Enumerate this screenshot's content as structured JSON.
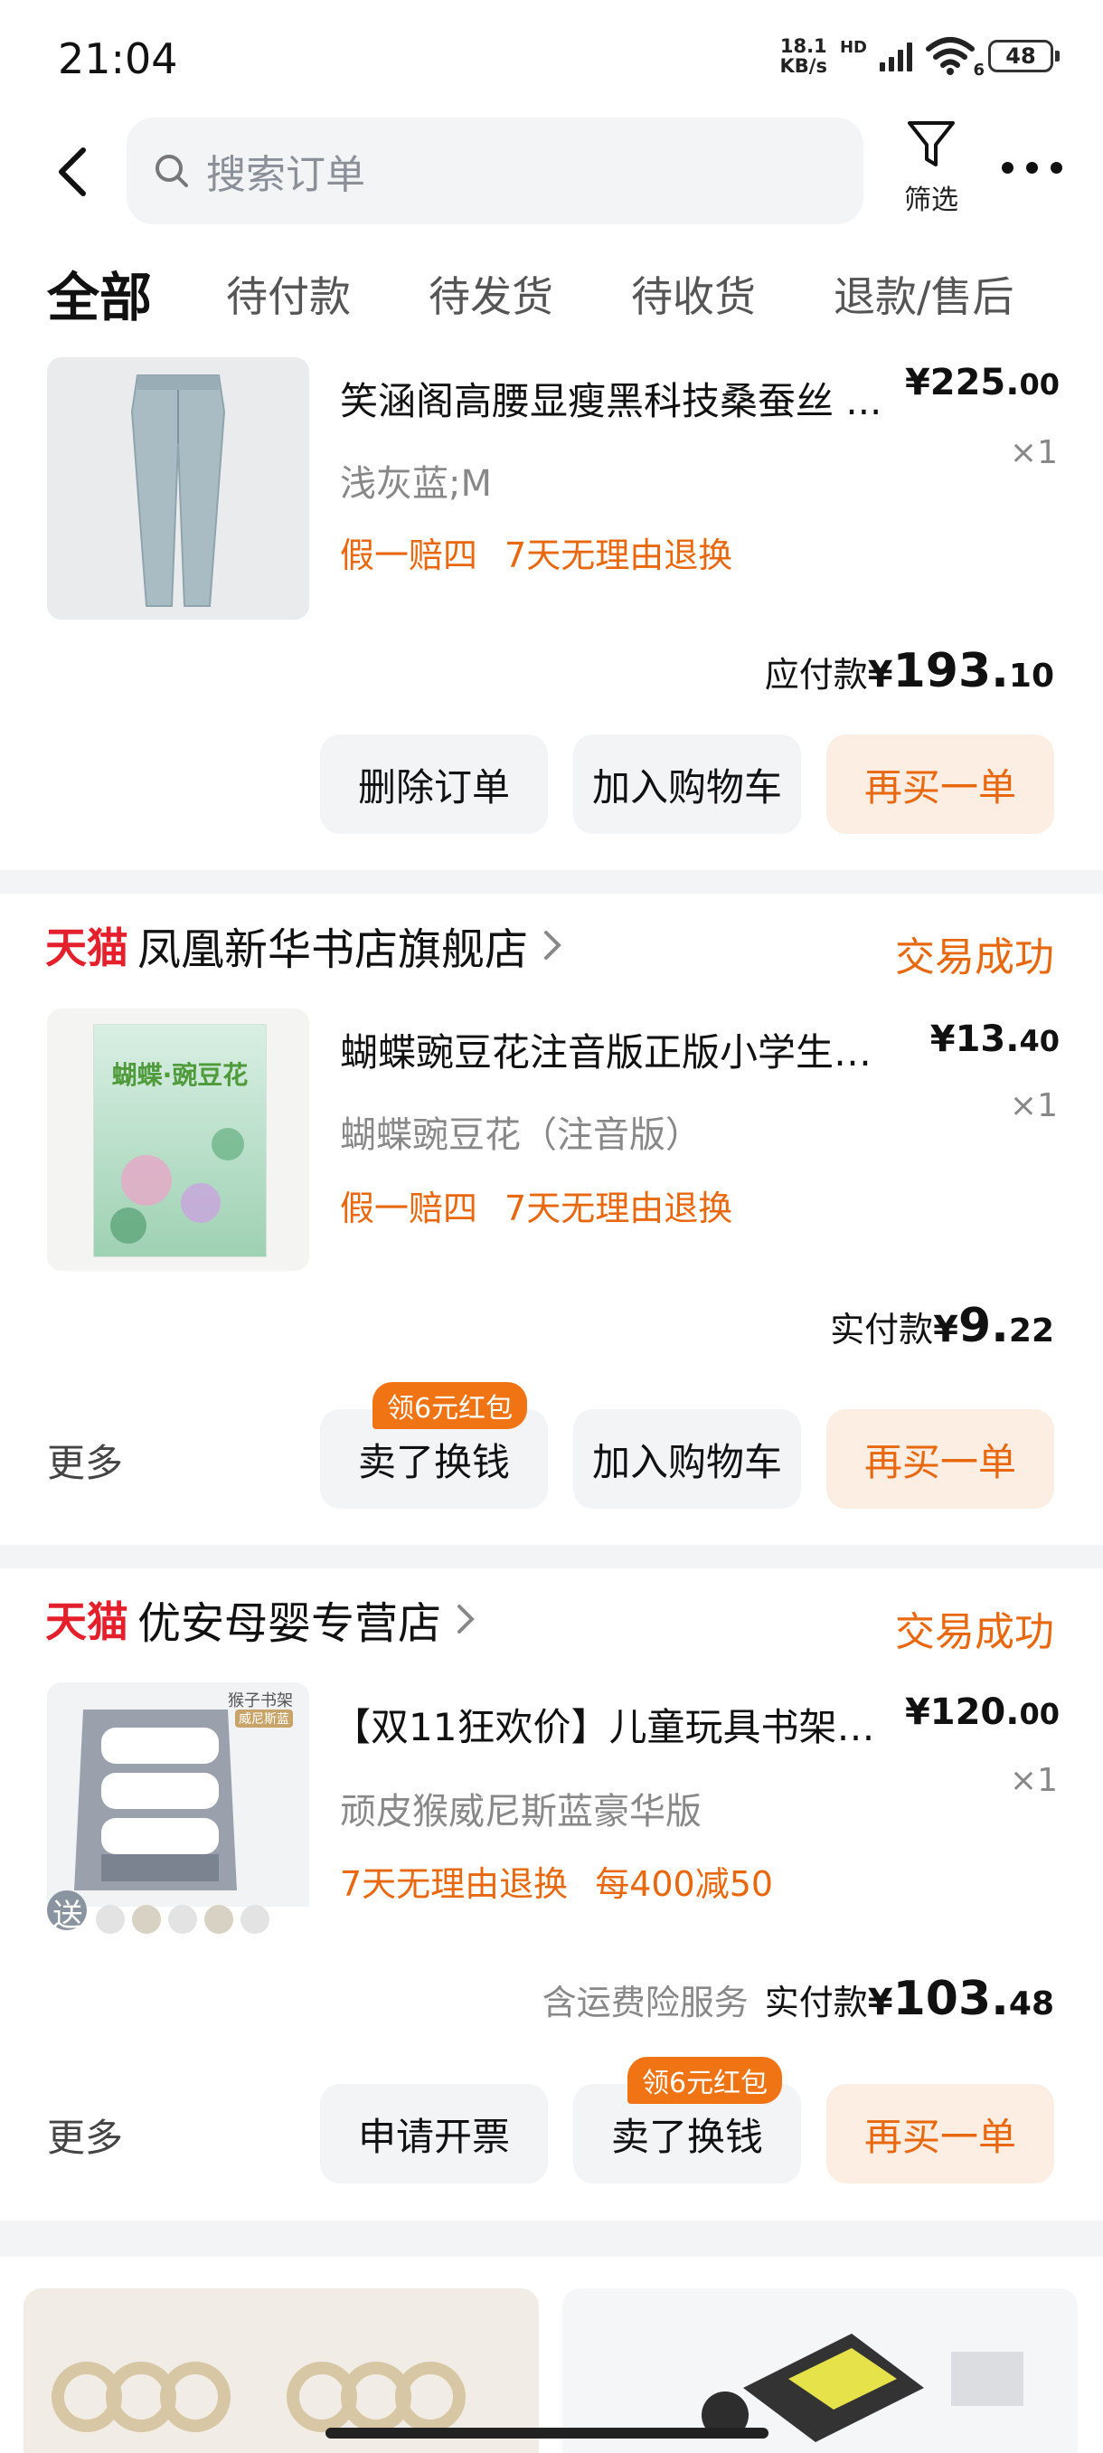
{
  "status_bar": {
    "time": "21:04",
    "net_speed_value": "18.1",
    "net_speed_unit": "KB/s",
    "hd": "HD",
    "wifi_badge": "6",
    "battery": "48"
  },
  "header": {
    "search_placeholder": "搜索订单",
    "filter_label": "筛选"
  },
  "tabs": [
    {
      "label": "全部",
      "active": true
    },
    {
      "label": "待付款"
    },
    {
      "label": "待发货"
    },
    {
      "label": "待收货"
    },
    {
      "label": "退款/售后"
    }
  ],
  "orders": [
    {
      "item": {
        "title": "笑涵阁高腰显瘦黑科技桑蚕丝 ...",
        "price_int": "¥225.",
        "price_dec": "00",
        "qty": "×1",
        "spec": "浅灰蓝;M",
        "tags": [
          "假一赔四",
          "7天无理由退换"
        ]
      },
      "pay_label": "应付款",
      "pay_currency": "¥",
      "pay_int": "193.",
      "pay_dec": "10",
      "buttons": [
        "删除订单",
        "加入购物车",
        "再买一单"
      ]
    },
    {
      "platform": "天猫",
      "shop": "凤凰新华书店旗舰店",
      "status": "交易成功",
      "item": {
        "title": "蝴蝶豌豆花注音版正版小学生一...",
        "price_int": "¥13.",
        "price_dec": "40",
        "qty": "×1",
        "spec": "蝴蝶豌豆花（注音版）",
        "tags": [
          "假一赔四",
          "7天无理由退换"
        ]
      },
      "cover_text": "蝴蝶·豌豆花",
      "pay_label": "实付款",
      "pay_currency": "¥",
      "pay_int": "9.",
      "pay_dec": "22",
      "more": "更多",
      "redpack": "领6元红包",
      "buttons": [
        "卖了换钱",
        "加入购物车",
        "再买一单"
      ]
    },
    {
      "platform": "天猫",
      "shop": "优安母婴专营店",
      "status": "交易成功",
      "item": {
        "title": "【双11狂欢价】儿童玩具书架家...",
        "price_int": "¥120.",
        "price_dec": "00",
        "qty": "×1",
        "spec": "顽皮猴威尼斯蓝豪华版",
        "tags": [
          "7天无理由退换",
          "每400减50"
        ]
      },
      "thumb_badge": "送",
      "thumb_label": "猴子书架",
      "thumb_sublabel": "威尼斯蓝",
      "pay_note": "含运费险服务",
      "pay_label": "实付款",
      "pay_currency": "¥",
      "pay_int": "103.",
      "pay_dec": "48",
      "more": "更多",
      "redpack": "领6元红包",
      "buttons": [
        "申请开票",
        "卖了换钱",
        "再买一单"
      ]
    }
  ],
  "colors": {
    "accent": "#e8680f",
    "tmall": "#e4202c",
    "button_bg": "#f3f4f6",
    "primary_button_bg": "#fdeee3"
  }
}
